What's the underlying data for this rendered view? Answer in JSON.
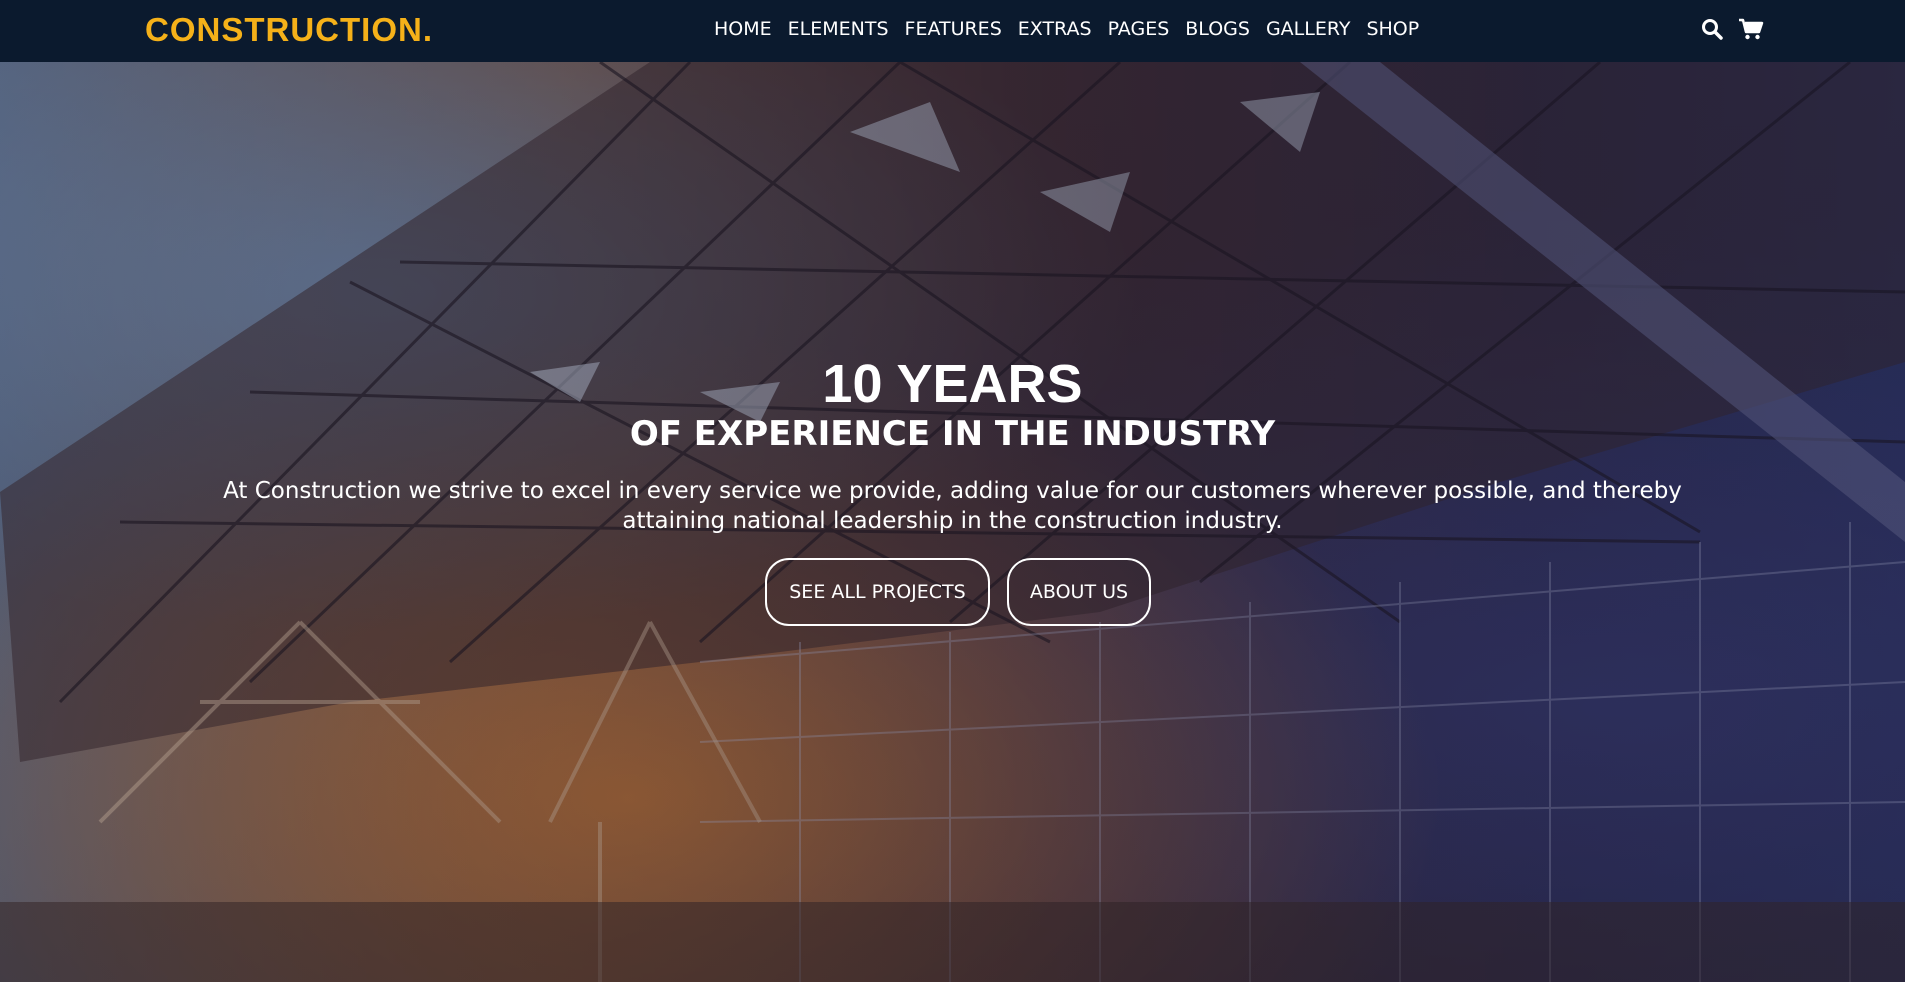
{
  "brand": {
    "logo_text": "CONSTRUCTION.",
    "accent_color": "#f5b119",
    "nav_bg": "#0b1a2e"
  },
  "nav": {
    "items": [
      {
        "label": "HOME"
      },
      {
        "label": "ELEMENTS"
      },
      {
        "label": "FEATURES"
      },
      {
        "label": "EXTRAS"
      },
      {
        "label": "PAGES"
      },
      {
        "label": "BLOGS"
      },
      {
        "label": "GALLERY"
      },
      {
        "label": "SHOP"
      }
    ],
    "icons": [
      "search-icon",
      "cart-icon"
    ]
  },
  "hero": {
    "title": "10 YEARS",
    "subtitle": "OF EXPERIENCE IN THE INDUSTRY",
    "description": "At Construction we strive to excel in every service we provide, adding value for our customers wherever possible, and thereby attaining national leadership in the construction industry.",
    "buttons": {
      "projects": "SEE ALL PROJECTS",
      "about": "ABOUT US"
    }
  }
}
